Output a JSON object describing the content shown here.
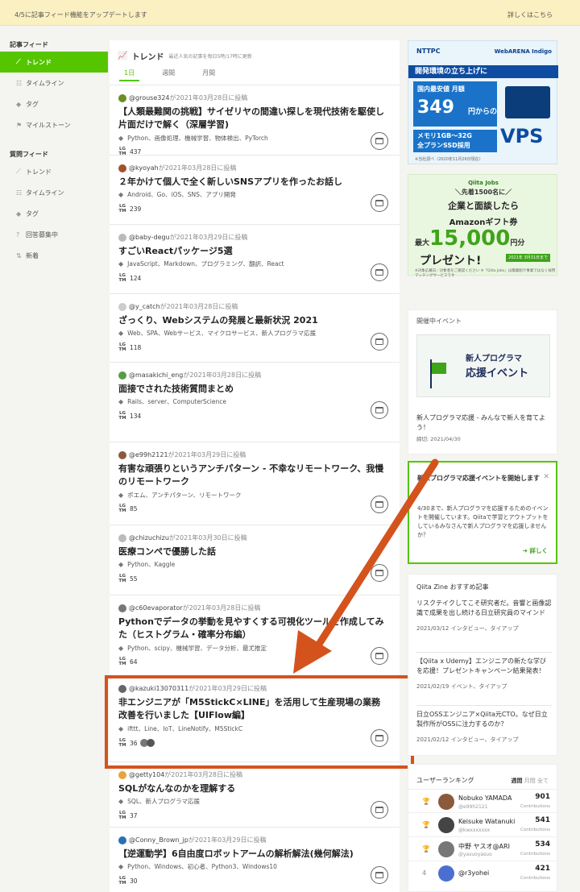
{
  "announcement": {
    "message": "4/5に記事フィード機能をアップデートします",
    "link": "詳しくはこちら"
  },
  "sidebar": {
    "article_feed_title": "記事フィード",
    "article_feed": [
      {
        "label": "トレンド",
        "icon": "trend-icon"
      },
      {
        "label": "タイムライン",
        "icon": "timeline-icon"
      },
      {
        "label": "タグ",
        "icon": "tag-icon"
      },
      {
        "label": "マイルストーン",
        "icon": "milestone-icon"
      }
    ],
    "question_feed_title": "質問フィード",
    "question_feed": [
      {
        "label": "トレンド",
        "icon": "trend-icon"
      },
      {
        "label": "タイムライン",
        "icon": "timeline-icon"
      },
      {
        "label": "タグ",
        "icon": "tag-icon"
      },
      {
        "label": "回答募集中",
        "icon": "question-icon"
      },
      {
        "label": "新着",
        "icon": "sort-icon"
      }
    ]
  },
  "feed": {
    "title": "トレンド",
    "subtitle": "最近人気の記事を毎日5時/17時に更新",
    "tabs": [
      "1日",
      "週間",
      "月間"
    ],
    "articles": [
      {
        "user": "@grouse324",
        "posted": "が2021年03月28日に投稿",
        "title": "【人類最難関の挑戦】サイゼリヤの間違い探しを現代技術を駆使し片面だけで解く（深層学習)",
        "tags": "Python、画像処理、機械学習、物体検出、PyTorch",
        "lgtm": "437",
        "avatar_color": "#6b8e23"
      },
      {
        "user": "@kyoyah",
        "posted": "が2021年03月28日に投稿",
        "title": "２年かけて個人で全く新しいSNSアプリを作ったお話し",
        "tags": "Android、Go、iOS、SNS、アプリ開発",
        "lgtm": "239",
        "avatar_color": "#a0522d"
      },
      {
        "user": "@baby-degu",
        "posted": "が2021年03月29日に投稿",
        "title": "すごいReactパッケージ5選",
        "tags": "JavaScript、Markdown、プログラミング、翻訳、React",
        "lgtm": "124",
        "avatar_color": "#bbbbbb"
      },
      {
        "user": "@y_catch",
        "posted": "が2021年03月28日に投稿",
        "title": "ざっくり、Webシステムの発展と最新状況 2021",
        "tags": "Web、SPA、Webサービス、マイクロサービス、新人プログラマ応援",
        "lgtm": "118",
        "avatar_color": "#cccccc"
      },
      {
        "user": "@masakichi_eng",
        "posted": "が2021年03月28日に投稿",
        "title": "面接でされた技術質問まとめ",
        "tags": "Rails、server、ComputerScience",
        "lgtm": "134",
        "avatar_color": "#5a9a4a"
      },
      {
        "user": "@e99h2121",
        "posted": "が2021年03月29日に投稿",
        "title": "有害な頑張りというアンチパターン - 不幸なリモートワーク、我慢のリモートワーク",
        "tags": "ポエム、アンチパターン、リモートワーク",
        "lgtm": "85",
        "avatar_color": "#8b5a3c"
      },
      {
        "user": "@chizuchizu",
        "posted": "が2021年03月30日に投稿",
        "title": "医療コンペで優勝した話",
        "tags": "Python、Kaggle",
        "lgtm": "55",
        "avatar_color": "#bbbbbb"
      },
      {
        "user": "@c60evaporator",
        "posted": "が2021年03月28日に投稿",
        "title": "Pythonでデータの挙動を見やすくする可視化ツールを作成してみた（ヒストグラム・確率分布編）",
        "tags": "Python、scipy、機械学習、データ分析、最尤推定",
        "lgtm": "64",
        "avatar_color": "#777777"
      },
      {
        "user": "@kazuki13070311",
        "posted": "が2021年03月29日に投稿",
        "title": "非エンジニアが「M5StickC×LINE」を活用して生産現場の業務改善を行いました【UIFlow編】",
        "tags": "ifttt、Line、IoT、LineNotify、M5StickC",
        "lgtm": "36",
        "avatar_color": "#666666"
      },
      {
        "user": "@getty104",
        "posted": "が2021年03月28日に投稿",
        "title": "SQLがなんなのかを理解する",
        "tags": "SQL、新人プログラマ応援",
        "lgtm": "37",
        "avatar_color": "#e8a33d"
      },
      {
        "user": "@Conny_Brown_jp",
        "posted": "が2021年03月29日に投稿",
        "title": "【逆運動学】6自由度ロボットアームの解析解法(幾何解法)",
        "tags": "Python、Windows、初心者、Python3、Windows10",
        "lgtm": "30",
        "avatar_color": "#2a6fb5"
      }
    ]
  },
  "ads": {
    "vps": {
      "brand": "NTTPC",
      "brand2": "WebARENA Indigo",
      "headline": "開発環境の立ち上げに",
      "p1": "国内最安値 月額",
      "price": "349",
      "p2": "円からの",
      "spec1": "メモリ1GB〜32G",
      "spec2": "全プランSSD採用",
      "product": "VPS",
      "note": "※当社調べ（2020年11月26日現在）"
    },
    "jobs": {
      "brand": "Qiita Jobs",
      "l1": "＼先着1500名に／",
      "l2": "企業と面談したら",
      "l3": "Amazonギフト券",
      "l4a": "最大",
      "l4b": "15,000",
      "l4c": "円分",
      "l5": "プレゼント!",
      "badge": "2021年 3月31日まで",
      "fine": "※対象応募日／対象者をご確認ください ※「Qiita Jobs」は職業紹介事業ではなく採用マッチングサービスです"
    }
  },
  "events": {
    "title": "開催中イベント",
    "banner_l1": "新人プログラマ",
    "banner_l2": "応援イベント",
    "text": "新人プログラマ応援 - みんなで新人を育てよう！",
    "date": "締切: 2021/04/30"
  },
  "popup": {
    "title": "新人プログラマ応援イベントを開始します",
    "body": "4/30まで、新人プログラマを応援するためのイベントを開催しています。Qiitaで学習とアウトプットをしているみなさんで新人プログラマを応援しませんか？",
    "link": "詳しく"
  },
  "zine": {
    "title": "Qiita Zine おすすめ記事",
    "items": [
      {
        "title": "リスクテイクしてこそ研究者だ。音響と画像認識で成果を出し続ける日立研究員のマインド",
        "meta": "2021/03/12  インタビュー、タイアップ"
      },
      {
        "title": "【Qiita x Udemy】エンジニアの新たな学びを応援！プレゼントキャンペーン結果発表！",
        "meta": "2021/02/19  イベント、タイアップ"
      },
      {
        "title": "日立OSSエンジニア×Qiita元CTO。なぜ日立製作所がOSSに注力するのか？",
        "meta": "2021/02/12  インタビュー、タイアップ"
      }
    ]
  },
  "ranking": {
    "title": "ユーザーランキング",
    "periods": [
      "週間",
      "月間",
      "全て"
    ],
    "rows": [
      {
        "pos": "🏆",
        "name": "Nobuko YAMADA",
        "user": "@e99h2121",
        "value": "901",
        "unit": "Contributions",
        "color": "#8b5a3c"
      },
      {
        "pos": "🏆",
        "name": "Keisuke Watanuki",
        "user": "@kwxxxxxxx",
        "value": "541",
        "unit": "Contributions",
        "color": "#444444"
      },
      {
        "pos": "🏆",
        "name": "中野 ヤスオ@ARI",
        "user": "@yasuoyasuo",
        "value": "534",
        "unit": "Contributions",
        "color": "#777777"
      },
      {
        "pos": "4",
        "name": "@r3yohei",
        "user": "",
        "value": "421",
        "unit": "Contributions",
        "color": "#4a6fd0"
      }
    ]
  }
}
